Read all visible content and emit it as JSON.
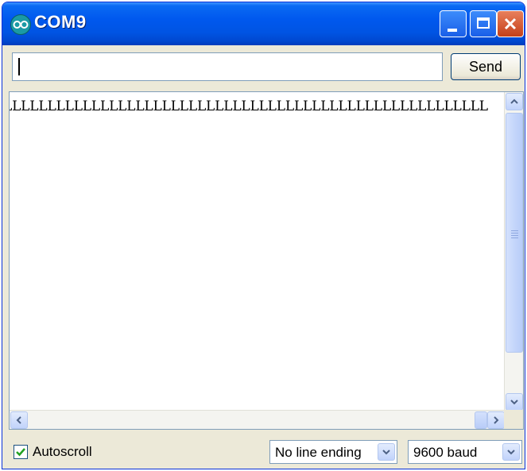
{
  "window": {
    "title": "COM9",
    "icon": "arduino-infinity-icon",
    "controls": [
      "minimize-icon",
      "maximize-icon",
      "close-icon"
    ]
  },
  "send_bar": {
    "input_value": "",
    "send_label": "Send"
  },
  "output": {
    "text": "LLLLLLLLLLLLLLLLLLLLLLLLLLLLLLLLLLLLLLLLLLLLLLLLLLLLLLL"
  },
  "footer": {
    "autoscroll_label": "Autoscroll",
    "autoscroll_checked": true,
    "line_ending_selected": "No line ending",
    "baud_selected": "9600 baud"
  },
  "colors": {
    "titlebar": "#0054e3",
    "window_bg": "#ece9d8",
    "close_button": "#c5401a",
    "scrollbar": "#c1d3fb"
  }
}
